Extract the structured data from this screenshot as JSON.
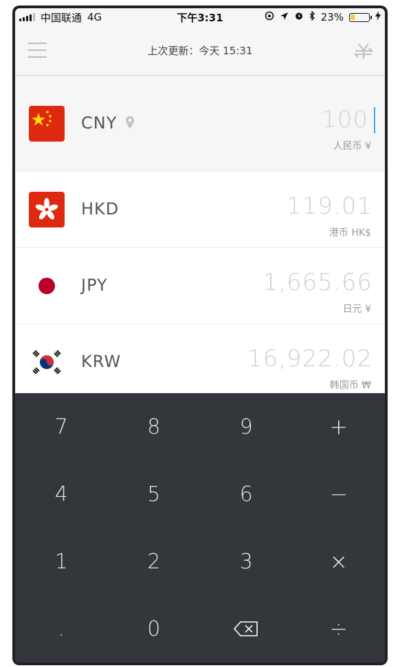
{
  "status_bar": {
    "carrier": "中国联通",
    "network": "4G",
    "time": "下午3:31",
    "battery": "23%",
    "battery_level": 0.23
  },
  "header": {
    "title": "上次更新：今天 15:31",
    "menu_icon": "menu-icon",
    "action_icon": "yen-swap-icon"
  },
  "currencies": [
    {
      "code": "CNY",
      "amount": "100",
      "unit": "人民币 ¥",
      "flag": "china-flag"
    },
    {
      "code": "HKD",
      "amount": "119.01",
      "unit": "港币 HK$",
      "flag": "hong-kong-flag"
    },
    {
      "code": "JPY",
      "amount": "1,665.66",
      "unit": "日元 ¥",
      "flag": "japan-flag"
    },
    {
      "code": "KRW",
      "amount": "16,922.02",
      "unit": "韩国币 ₩",
      "flag": "korea-flag"
    }
  ],
  "keypad": {
    "keys": [
      "7",
      "8",
      "9",
      "+",
      "4",
      "5",
      "6",
      "−",
      "1",
      "2",
      "3",
      "×",
      ".",
      "0",
      "⌫",
      "÷"
    ]
  },
  "colors": {
    "keypad_bg": "#33363b",
    "cursor": "#39a7e0",
    "battery_fill": "#f3c43a",
    "china_red": "#de2910",
    "japan_red": "#bc002d"
  }
}
